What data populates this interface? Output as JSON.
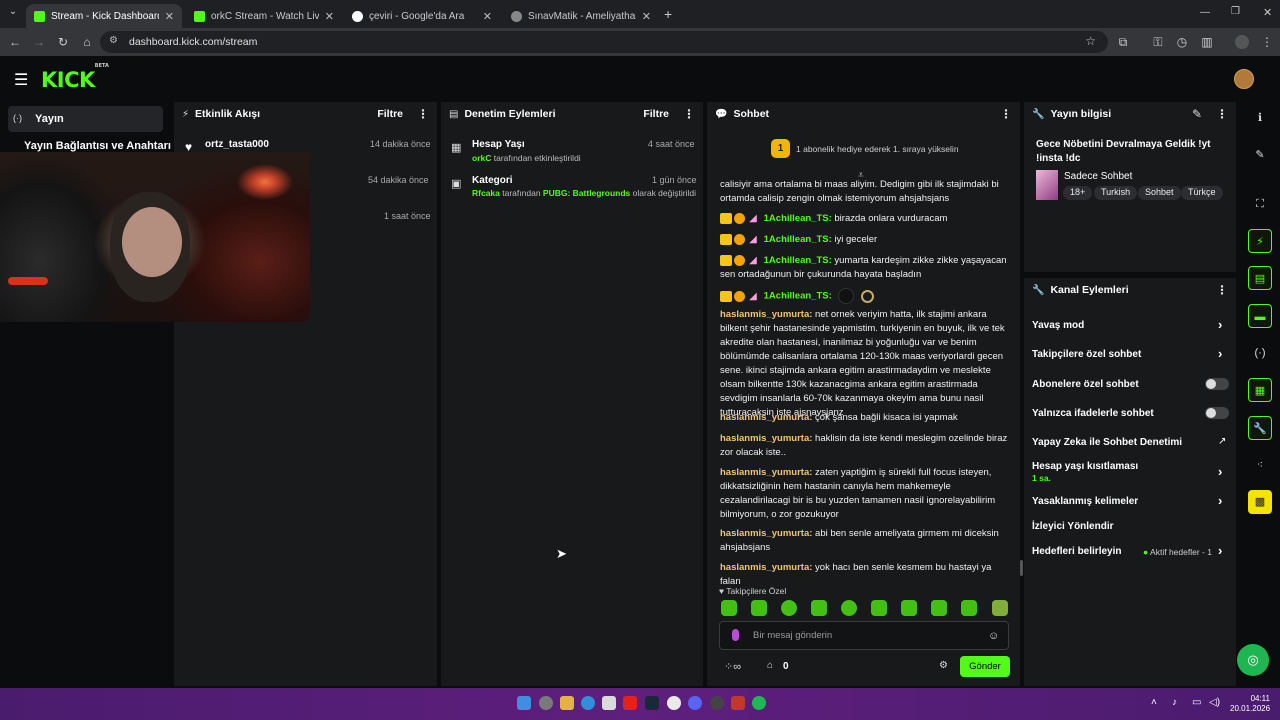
{
  "browser": {
    "tabs": [
      {
        "title": "Stream - Kick Dashboard",
        "favicon": "kick-icon",
        "active": true
      },
      {
        "title": "orkC Stream - Watch Live on Kick",
        "favicon": "kick-icon",
        "active": false
      },
      {
        "title": "çeviri - Google'da Ara",
        "favicon": "google-icon",
        "active": false
      },
      {
        "title": "SınavMatik - Ameliyathane ve Y",
        "favicon": "globe-icon",
        "active": false
      }
    ],
    "url": "dashboard.kick.com/stream"
  },
  "header": {
    "logo": "KICK",
    "logo_badge": "BETA",
    "accent": "#53fc18"
  },
  "sidebar": {
    "items": [
      {
        "label": "Yayın",
        "icon": "broadcast-icon"
      },
      {
        "label": "Yayın Bağlantısı ve Anahtarı"
      }
    ]
  },
  "activity": {
    "title": "Etkinlik Akışı",
    "filter": "Filtre",
    "events": [
      {
        "user": "ortz_tasta000",
        "time": "14 dakika önce"
      },
      {
        "user": "",
        "time": "54 dakika önce"
      },
      {
        "user": "",
        "time": "1 saat önce"
      }
    ]
  },
  "moderation": {
    "title": "Denetim Eylemleri",
    "filter": "Filtre",
    "events": [
      {
        "title": "Hesap Yaşı",
        "actor": "orkC",
        "text": "tarafından etkinleştirildi",
        "time": "4 saat önce"
      },
      {
        "title": "Kategori",
        "actor": "Rfcaka",
        "text1": "tarafından",
        "value": "PUBG: Battlegrounds",
        "text2": "olarak değiştirildi",
        "time": "1 gün önce"
      }
    ]
  },
  "chat": {
    "title": "Sohbet",
    "pinned": "1 abonelik hediye ederek 1. sıraya yükselin",
    "pinned_rank": "1",
    "first_msg": "calisiyir ama ortalama bi maas aliyim. Dedigim gibi ilk stajimdaki bi ortamda calisip zengin olmak istemiyorum ahsjahsjans",
    "messages": [
      {
        "user": "1Achillean_TS:",
        "text": "birazda onlara vurduracam"
      },
      {
        "user": "1Achillean_TS:",
        "text": "iyi geceler"
      },
      {
        "user": "1Achillean_TS:",
        "text": "yumarta kardeşim zikke zikke yaşayacan sen ortadağunun bir çukurunda hayata başladın"
      },
      {
        "user": "1Achillean_TS:",
        "text": ""
      },
      {
        "user": "haslanmis_yumurta:",
        "text": "net ornek veriyim hatta, ilk stajimi ankara bilkent şehir hastanesinde yapmistim. turkiyenin en buyuk, ilk ve tek akredite olan hastanesi, inanilmaz bi yoğunluğu var ve benim bölümümde calisanlara ortalama 120-130k maas veriyorlardi gecen sene. ikinci stajimda ankara egitim arastirmadaydim ve meslekte olsam bilkentte 130k kazanacgima ankara egitim arastirmada sevdigim insanlarla 60-70k kazanmaya okeyim ama bunu nasil tutturacaksin iste ajsnavsjanz"
      },
      {
        "user": "haslanmis_yumurta:",
        "text": "çok şansa bağli kisaca isi yapmak"
      },
      {
        "user": "haslanmis_yumurta:",
        "text": "haklisin da iste kendi meslegim ozelinde biraz zor olacak iste.."
      },
      {
        "user": "haslanmis_yumurta:",
        "text": "zaten yaptiğim iş sürekli full focus isteyen, dikkatsizliğinin hem hastanin canıyla hem mahkemeyle cezalandirilacagi bir is bu yuzden tamamen nasil ignorelayabilirim bilmiyorum, o zor gozukuyor"
      },
      {
        "user": "haslanmis_yumurta:",
        "text": "abi ben senle ameliyata girmem mi diceksin ahsjabsjans"
      },
      {
        "user": "haslanmis_yumurta:",
        "text": "yok hacı ben senle kesmem bu hastayi ya falan"
      }
    ],
    "followers_only": "Takipçilere Özel",
    "input_placeholder": "Bir mesaj gönderin",
    "points": "0",
    "send": "Gönder"
  },
  "stream_info": {
    "title": "Yayın bilgisi",
    "stream_title": "Gece Nöbetini Devralmaya Geldik !yt !insta !dc",
    "category": "Sadece Sohbet",
    "tags": [
      "18+",
      "Turkish",
      "Sohbet",
      "Türkçe"
    ]
  },
  "channel_actions": {
    "title": "Kanal Eylemleri",
    "items": [
      {
        "label": "Yavaş mod",
        "control": "chevron"
      },
      {
        "label": "Takipçilere özel sohbet",
        "control": "chevron"
      },
      {
        "label": "Abonelere özel sohbet",
        "control": "toggle"
      },
      {
        "label": "Yalnızca ifadelerle sohbet",
        "control": "toggle"
      },
      {
        "label": "Yapay Zeka ile Sohbet Denetimi",
        "control": "external"
      },
      {
        "label": "Hesap yaşı kısıtlaması",
        "sub": "1 sa.",
        "control": "chevron"
      },
      {
        "label": "Yasaklanmış kelimeler",
        "control": "chevron"
      },
      {
        "label": "İzleyici Yönlendir",
        "control": "none"
      },
      {
        "label": "Hedefleri belirleyin",
        "sub": "Aktif hedefler - 1",
        "control": "chevron"
      }
    ]
  },
  "taskbar": {
    "time": "04:11",
    "date": "20.01.2026"
  }
}
